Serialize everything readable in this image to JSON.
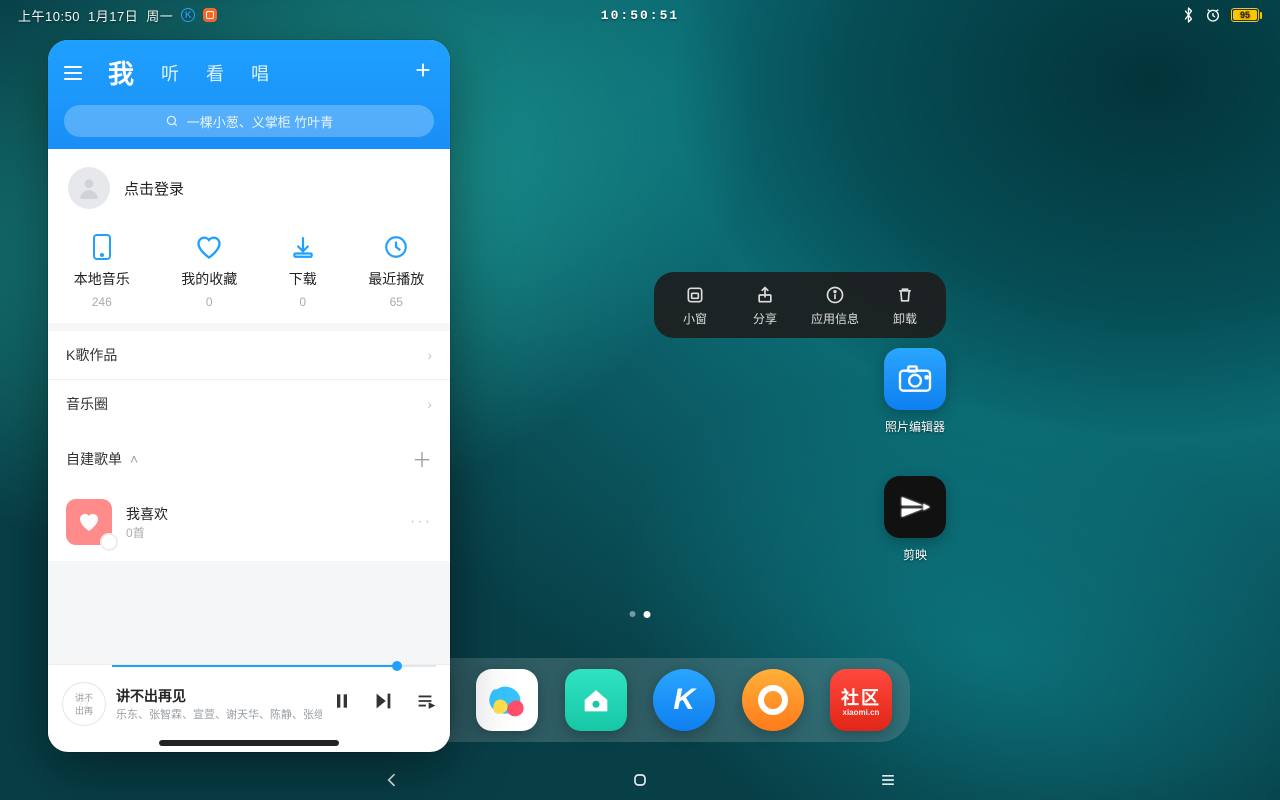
{
  "statusbar": {
    "time_left": "上午10:50",
    "date": "1月17日",
    "weekday": "周一",
    "clock_center": "10:50:51",
    "battery_percent": "95"
  },
  "popup": {
    "small_window": "小窗",
    "share": "分享",
    "app_info": "应用信息",
    "uninstall": "卸载"
  },
  "desktop": {
    "photo_editor": "照片编辑器",
    "capcut": "剪映"
  },
  "dock": {
    "community_main": "社区",
    "community_sub": "xiaomi.cn"
  },
  "kugou": {
    "tabs": {
      "me": "我",
      "listen": "听",
      "watch": "看",
      "sing": "唱"
    },
    "search_placeholder": "一棵小葱、义掌柜 竹叶青",
    "login_prompt": "点击登录",
    "quick": {
      "local": {
        "label": "本地音乐",
        "count": "246"
      },
      "favorite": {
        "label": "我的收藏",
        "count": "0"
      },
      "download": {
        "label": "下载",
        "count": "0"
      },
      "recent": {
        "label": "最近播放",
        "count": "65"
      }
    },
    "rows": {
      "karaoke": "K歌作品",
      "music_circle": "音乐圈"
    },
    "section": {
      "own_playlists": "自建歌单"
    },
    "playlist": {
      "title": "我喜欢",
      "sub": "0首"
    },
    "now_playing": {
      "song": "讲不出再见",
      "artists": "乐东、张智霖、宣萱、谢天华、陈静、张继聪、夏"
    }
  }
}
